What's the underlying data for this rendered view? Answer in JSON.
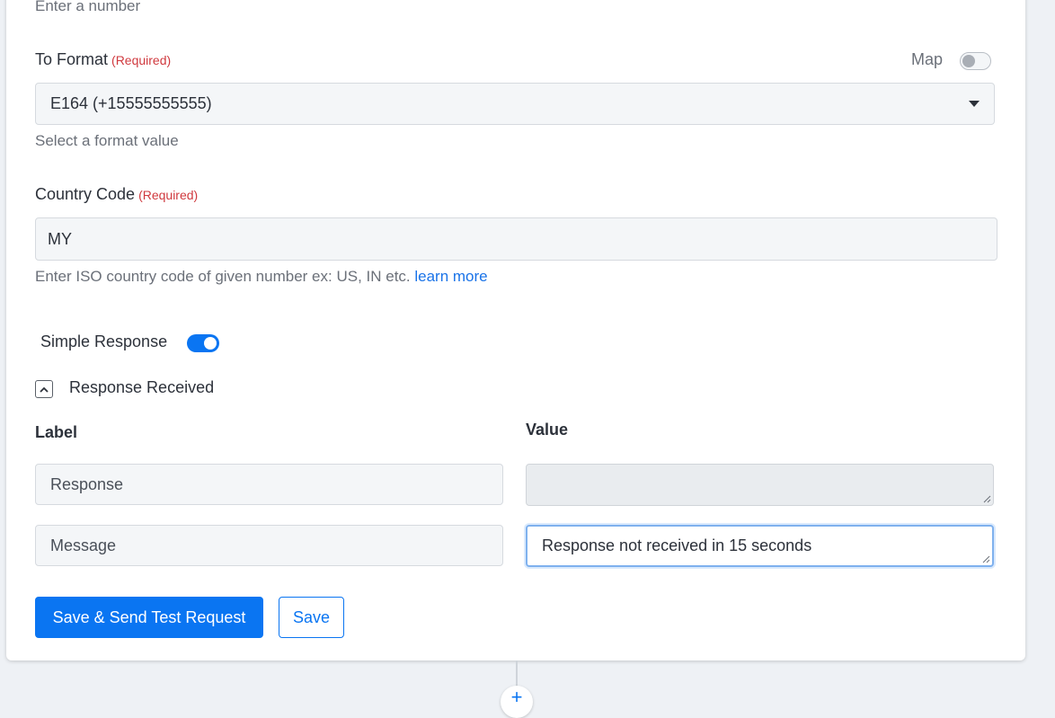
{
  "number_field": {
    "hint": "Enter a number"
  },
  "to_format": {
    "label": "To Format",
    "required": "(Required)",
    "map_label": "Map",
    "value": "E164 (+15555555555)",
    "hint": "Select a format value"
  },
  "country_code": {
    "label": "Country Code",
    "required": "(Required)",
    "value": "MY",
    "hint": "Enter ISO country code of given number ex: US, IN etc.",
    "learn_more": "learn more"
  },
  "simple_response": {
    "label": "Simple Response",
    "enabled": true
  },
  "response_received": {
    "title": "Response Received",
    "col_label": "Label",
    "col_value": "Value",
    "rows": [
      {
        "label": "Response",
        "value": ""
      },
      {
        "label": "Message",
        "value": "Response not received in 15 seconds"
      }
    ]
  },
  "actions": {
    "save_send": "Save & Send Test Request",
    "save": "Save"
  },
  "colors": {
    "primary": "#0a75f2",
    "required": "#d0393e",
    "link": "#1a73e8"
  }
}
